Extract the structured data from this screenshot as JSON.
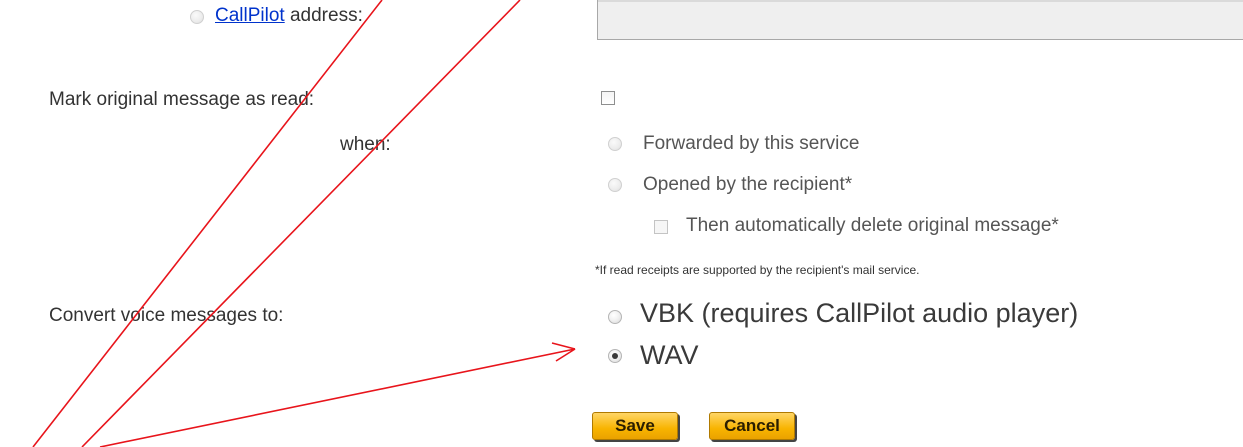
{
  "callpilot": {
    "link_text": "CallPilot",
    "suffix": " address:"
  },
  "mark_read": {
    "label": "Mark original message as read:",
    "when_label": "when:"
  },
  "options": {
    "forwarded": "Forwarded by this service",
    "opened": "Opened by the recipient*",
    "auto_delete": "Then automatically delete original message*"
  },
  "note": "*If read receipts are supported by the recipient's mail service.",
  "convert": {
    "label": "Convert voice messages to:",
    "vbk": "VBK (requires CallPilot audio player)",
    "wav": "WAV",
    "selected": "WAV"
  },
  "buttons": {
    "save": "Save",
    "cancel": "Cancel"
  },
  "colors": {
    "annotation": "#e8141b",
    "button": "#f8b400",
    "link": "#0033cc"
  }
}
